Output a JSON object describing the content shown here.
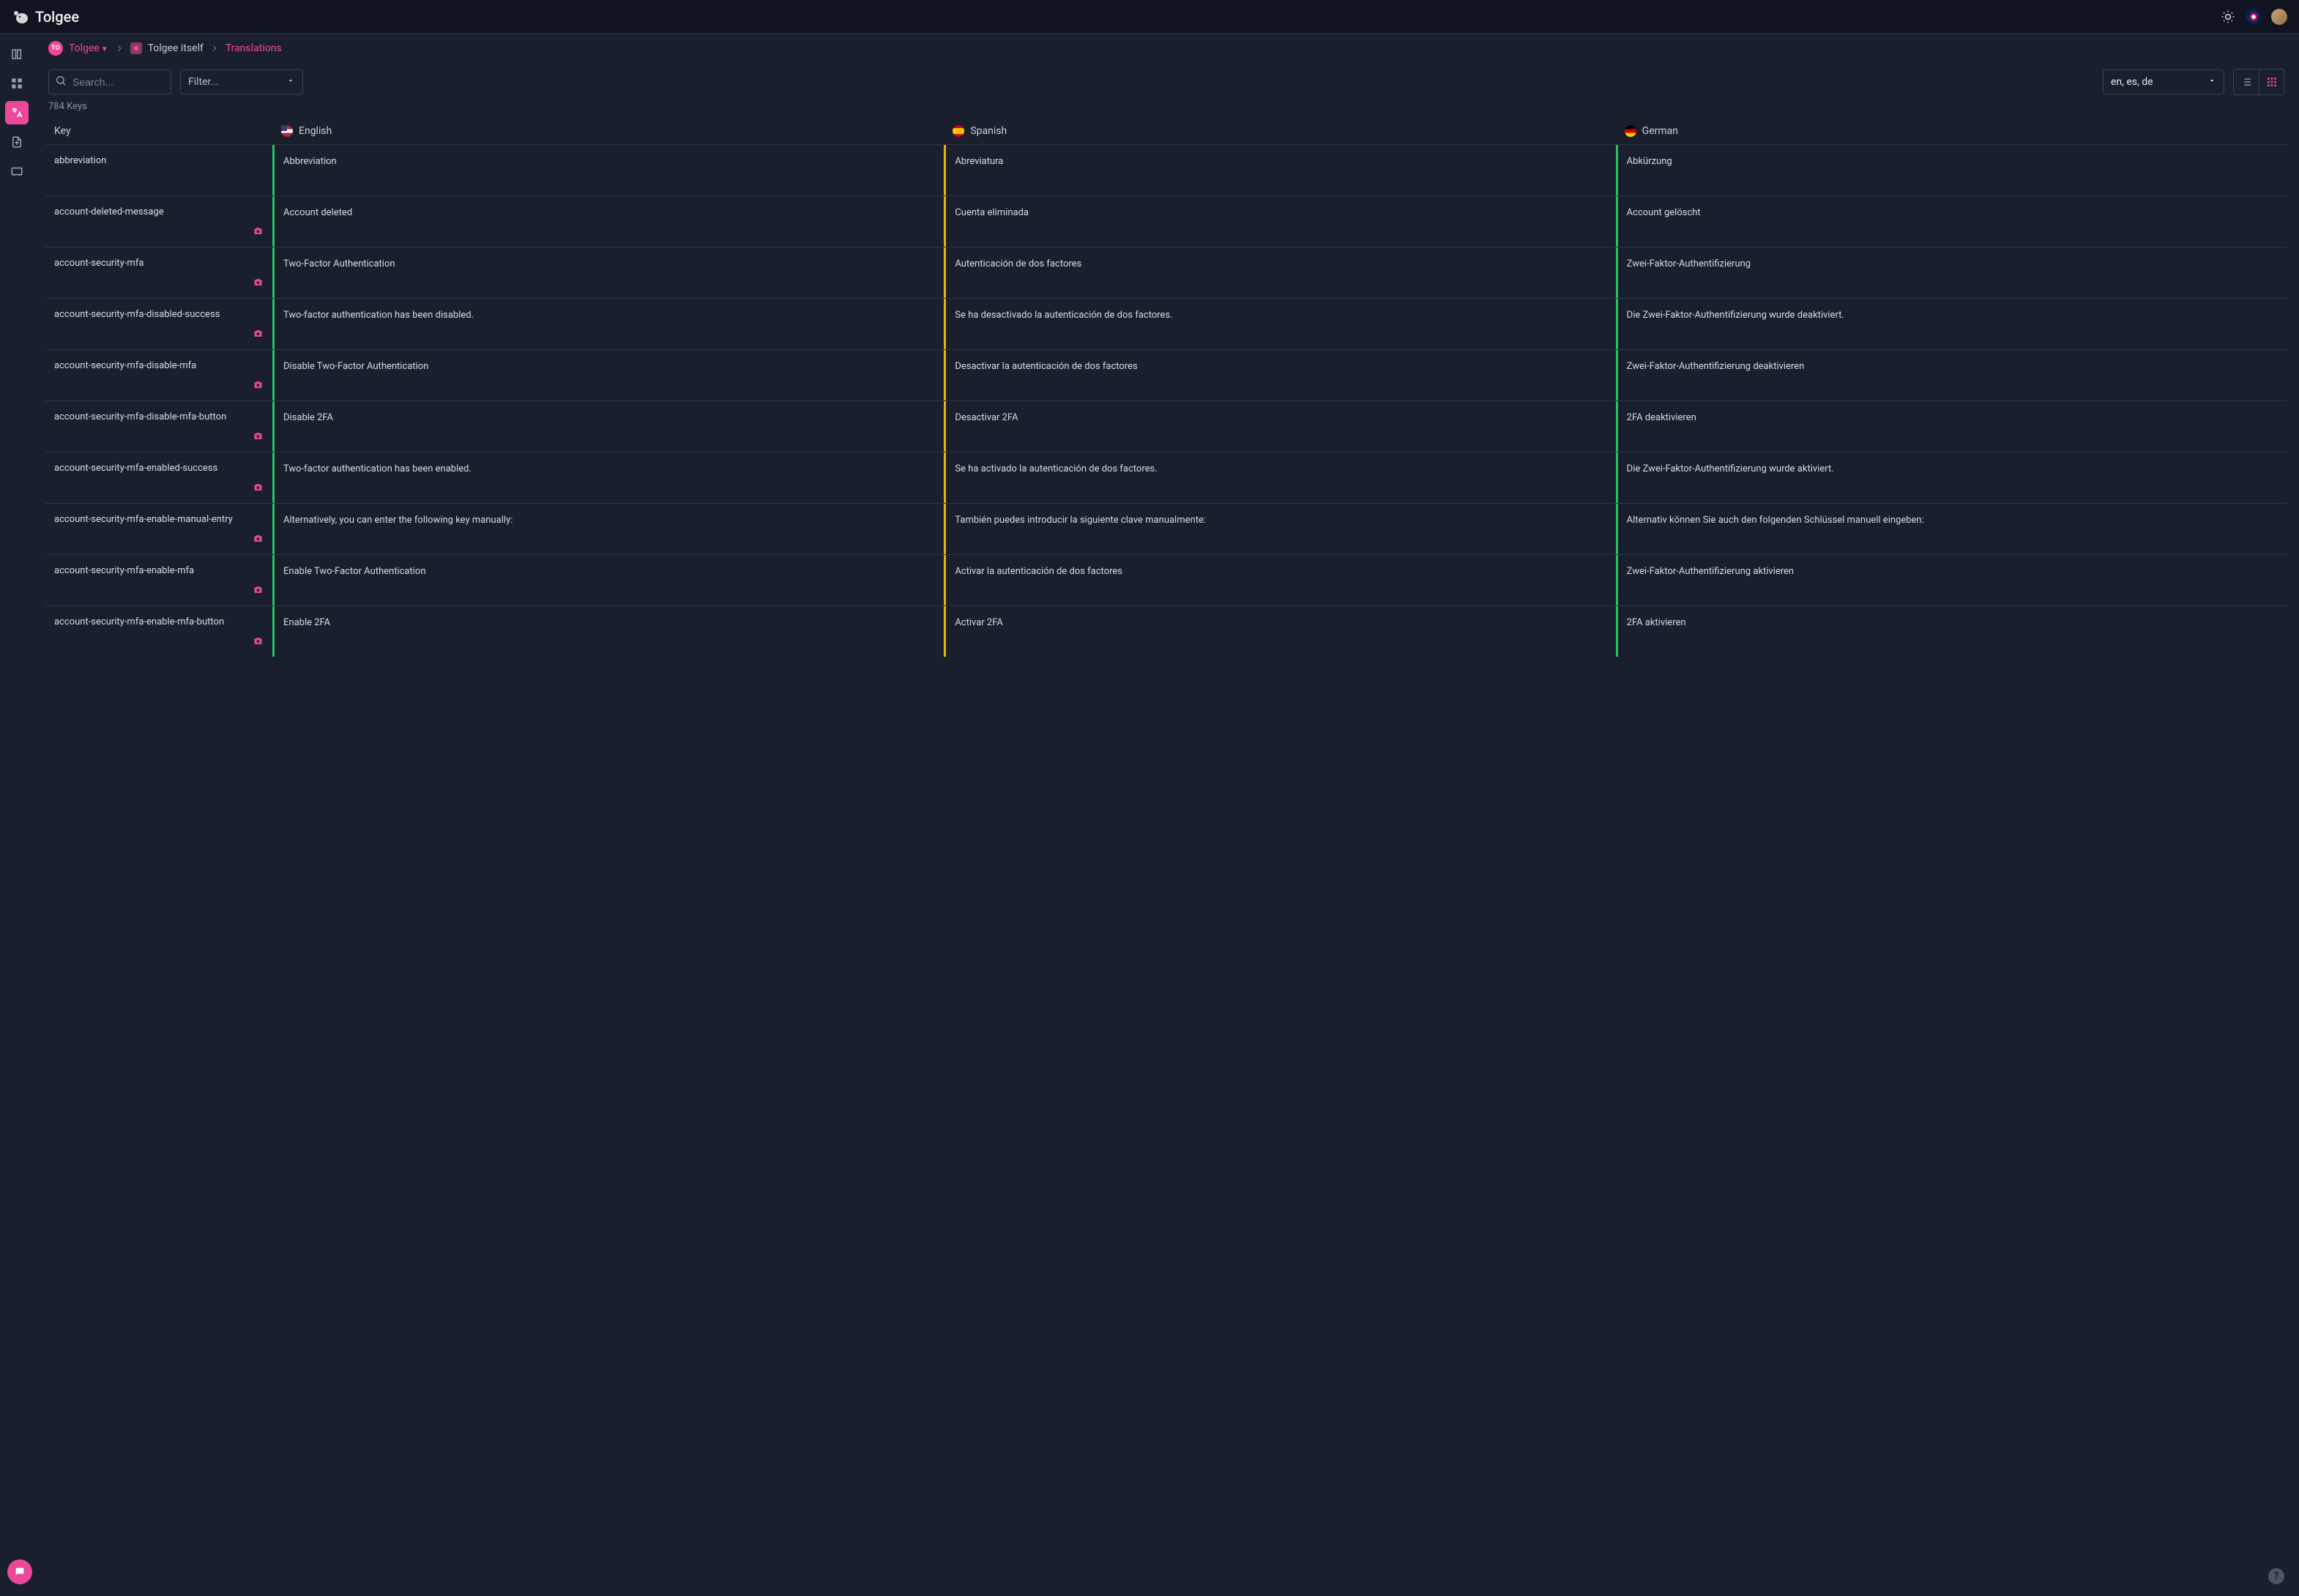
{
  "brand": {
    "name": "Tolgee"
  },
  "breadcrumb": {
    "org_badge": "TO",
    "org": "Tolgee",
    "project": "Tolgee itself",
    "section": "Translations"
  },
  "search": {
    "placeholder": "Search..."
  },
  "filter": {
    "label": "Filter..."
  },
  "langSelect": {
    "label": "en, es, de"
  },
  "keysCount": "784 Keys",
  "columns": {
    "key": "Key",
    "en": "English",
    "es": "Spanish",
    "de": "German"
  },
  "rows": [
    {
      "key": "abbreviation",
      "screenshot": false,
      "en": "Abbreviation",
      "es": "Abreviatura",
      "de": "Abkürzung"
    },
    {
      "key": "account-deleted-message",
      "screenshot": true,
      "en": "Account deleted",
      "es": "Cuenta eliminada",
      "de": "Account gelöscht"
    },
    {
      "key": "account-security-mfa",
      "screenshot": true,
      "en": "Two-Factor Authentication",
      "es": "Autenticación de dos factores",
      "de": "Zwei-Faktor-Authentifizierung"
    },
    {
      "key": "account-security-mfa-disabled-success",
      "screenshot": true,
      "en": "Two-factor authentication has been disabled.",
      "es": "Se ha desactivado la autenticación de dos factores.",
      "de": "Die Zwei-Faktor-Authentifizierung wurde deaktiviert."
    },
    {
      "key": "account-security-mfa-disable-mfa",
      "screenshot": true,
      "en": "Disable Two-Factor Authentication",
      "es": "Desactivar la autenticación de dos factores",
      "de": "Zwei-Faktor-Authentifizierung deaktivieren"
    },
    {
      "key": "account-security-mfa-disable-mfa-button",
      "screenshot": true,
      "en": "Disable 2FA",
      "es": "Desactivar 2FA",
      "de": "2FA deaktivieren"
    },
    {
      "key": "account-security-mfa-enabled-success",
      "screenshot": true,
      "en": "Two-factor authentication has been enabled.",
      "es": "Se ha activado la autenticación de dos factores.",
      "de": "Die Zwei-Faktor-Authentifizierung wurde aktiviert."
    },
    {
      "key": "account-security-mfa-enable-manual-entry",
      "screenshot": true,
      "en": "Alternatively, you can enter the following key manually:",
      "es": "También puedes introducir la siguiente clave manualmente:",
      "de": "Alternativ können Sie auch den folgenden Schlüssel manuell eingeben:"
    },
    {
      "key": "account-security-mfa-enable-mfa",
      "screenshot": true,
      "en": "Enable Two-Factor Authentication",
      "es": "Activar la autenticación de dos factores",
      "de": "Zwei-Faktor-Authentifizierung aktivieren"
    },
    {
      "key": "account-security-mfa-enable-mfa-button",
      "screenshot": true,
      "en": "Enable 2FA",
      "es": "Activar 2FA",
      "de": "2FA aktivieren"
    }
  ]
}
